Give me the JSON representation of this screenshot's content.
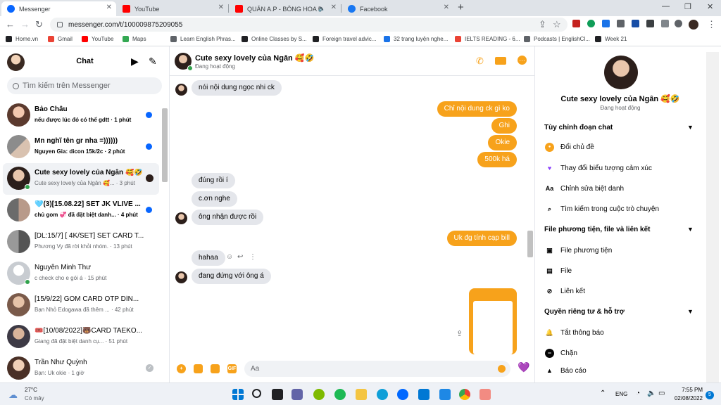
{
  "browser": {
    "tabs": [
      {
        "title": "Messenger",
        "active": true,
        "color": "#0866ff"
      },
      {
        "title": "YouTube",
        "active": false,
        "color": "#ff0000"
      },
      {
        "title": "QUÂN A.P - BÔNG HOA ĐẸP",
        "active": false,
        "color": "#ff0000"
      },
      {
        "title": "Facebook",
        "active": false,
        "color": "#1877f2"
      }
    ],
    "url": "messenger.com/t/100009875209055",
    "bookmarks": [
      "Home.vn",
      "Gmail",
      "YouTube",
      "Maps",
      "Learn English Phras...",
      "Online Classes by S...",
      "Foreign travel advic...",
      "32 trang luyện nghe...",
      "IELTS READING - 6...",
      "Podcasts | EnglishCl...",
      "Week 21"
    ]
  },
  "sidebar": {
    "title": "Chat",
    "search_placeholder": "Tìm kiếm trên Messenger",
    "conversations": [
      {
        "name": "Bảo Châu",
        "preview": "nếu được lúc đó có thể gdtt · 1 phút",
        "unread": true,
        "bold_preview": true
      },
      {
        "name": "Mn nghĩ tên gr nha =))))))",
        "preview": "Nguyen Gia: dicon 15k/2c · 2 phút",
        "unread": true,
        "bold_preview": true
      },
      {
        "name": "Cute sexy lovely của Ngân 🥰🤣",
        "preview": "Cute sexy lovely của Ngân 🥰... · 3 phút",
        "selected": true
      },
      {
        "name": "🩵(3)[15.08.22] SET JK VLIVE ...",
        "preview": "chủ gom 💞 đã đặt biệt danh... · 4 phút",
        "unread": true,
        "bold_preview": true
      },
      {
        "name": "[DL:15/7] [ 4K/SET] SET CARD T...",
        "preview": "Phương Vy đã rời khỏi nhóm. · 13 phút"
      },
      {
        "name": "Nguyễn Minh Thư",
        "preview": "c check cho e gói á · 15 phút",
        "online": true
      },
      {
        "name": "[15/9/22] GOM CARD OTP DÍN...",
        "preview": "Bạn Nhỏ Edogawa đã thêm ... · 42 phút"
      },
      {
        "name": "🎟️[10/08/2022]🐻CARD TAEKO...",
        "preview": "Giang đã đặt biệt danh cụ... · 51 phút"
      },
      {
        "name": "Trần Như Quỳnh",
        "preview": "Bạn: Uk okie · 1 giờ"
      }
    ]
  },
  "chat": {
    "name": "Cute sexy lovely của Ngân 🥰🤣",
    "status": "Đang hoạt động",
    "messages": [
      {
        "dir": "in",
        "text": "nói nội dung ngọc nhi ck"
      },
      {
        "dir": "out",
        "text": "Chỉ nội dung ck gì ko"
      },
      {
        "dir": "out",
        "text": "Ghi"
      },
      {
        "dir": "out",
        "text": "Okie"
      },
      {
        "dir": "out",
        "text": "500k há"
      },
      {
        "dir": "in",
        "text": "đúng rồi í"
      },
      {
        "dir": "in",
        "text": "c.ơn nghe"
      },
      {
        "dir": "in",
        "text": "ông nhận được rồi"
      },
      {
        "dir": "out",
        "text": "Uk đg tính cạp bill"
      },
      {
        "dir": "in",
        "text": "hahaa"
      },
      {
        "dir": "in",
        "text": "đang đứng với ông á"
      }
    ],
    "input_placeholder": "Aa",
    "accent": "#f7a21b"
  },
  "info": {
    "name": "Cute sexy lovely của Ngân 🥰🤣",
    "status": "Đang hoạt động",
    "sections": {
      "customize": "Tùy chỉnh đoạn chat",
      "media": "File phương tiện, file và liên kết",
      "privacy": "Quyền riêng tư & hỗ trợ"
    },
    "options": {
      "theme": "Đổi chủ đề",
      "emoji": "Thay đổi biểu tượng cảm xúc",
      "nickname": "Chỉnh sửa biệt danh",
      "search": "Tìm kiếm trong cuộc trò chuyện",
      "media_files": "File phương tiện",
      "files": "File",
      "links": "Liên kết",
      "mute": "Tắt thông báo",
      "block": "Chặn",
      "report": "Báo cáo"
    },
    "icons": {
      "theme": "Aa",
      "nickname": "Aa"
    }
  },
  "taskbar": {
    "temperature": "27°C",
    "weather": "Có mây",
    "lang": "ENG",
    "time": "7:55 PM",
    "date": "02/08/2022",
    "badge": "5"
  }
}
